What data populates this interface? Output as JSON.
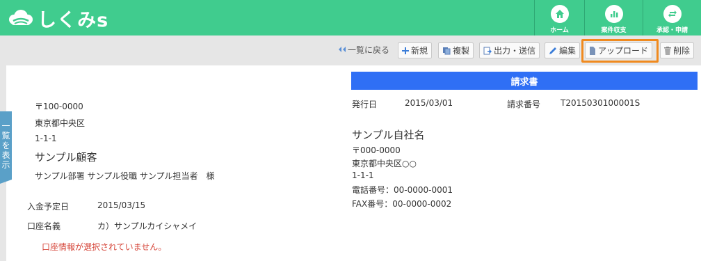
{
  "header": {
    "logo_text": "しくみs",
    "nav": [
      {
        "label": "ホーム",
        "icon": "home-icon"
      },
      {
        "label": "案件収支",
        "icon": "bar-chart-icon"
      },
      {
        "label": "承認・申請",
        "icon": "cycle-icon"
      }
    ],
    "bg_color": "#40cc8e"
  },
  "toolbar": {
    "back_label": "一覧に戻る",
    "new_label": "新規",
    "copy_label": "複製",
    "output_label": "出力・送信",
    "edit_label": "編集",
    "upload_label": "アップロード",
    "delete_label": "削除"
  },
  "sidetab": {
    "chars": [
      "一",
      "覧",
      "を",
      "表",
      "示"
    ]
  },
  "recipient": {
    "postal": "〒100-0000",
    "address1": "東京都中央区",
    "address2": "1-1-1",
    "name": "サンプル顧客",
    "person": "サンプル部署 サンプル役職 サンプル担当者　様"
  },
  "payment": {
    "due_label": "入金予定日",
    "due_value": "2015/03/15",
    "account_label": "口座名義",
    "account_value": "カ）サンプルカイシャメイ",
    "error": "口座情報が選択されていません。"
  },
  "invoice": {
    "title": "請求書",
    "issue_label": "発行日",
    "issue_value": "2015/03/01",
    "number_label": "請求番号",
    "number_value": "T2015030100001S"
  },
  "company": {
    "name": "サンプル自社名",
    "postal": "〒000-0000",
    "address1": "東京都中央区○○",
    "address2": "1-1-1",
    "tel": "電話番号：00-0000-0001",
    "fax": "FAX番号：00-0000-0002"
  },
  "colors": {
    "accent": "#2f6ff5",
    "highlight": "#f08a1f",
    "error": "#d6473b"
  }
}
